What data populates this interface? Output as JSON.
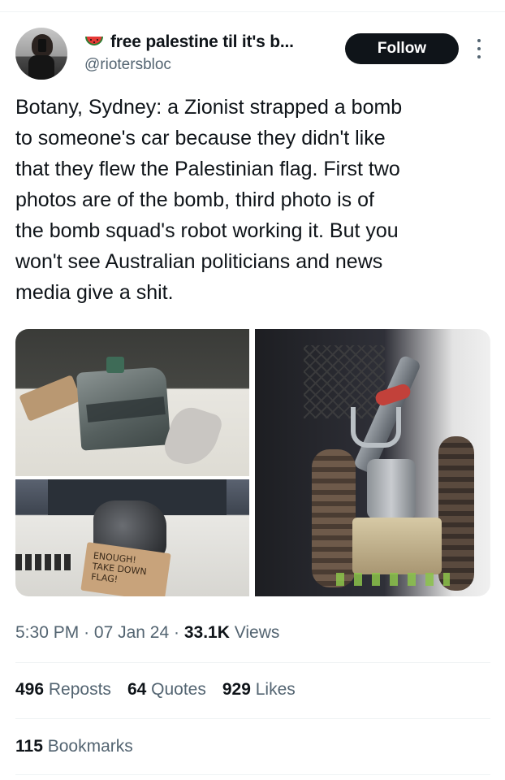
{
  "author": {
    "display_name": "free palestine til it's b...",
    "handle": "@riotersbloc",
    "emoji_icon": "watermelon-icon"
  },
  "follow_label": "Follow",
  "tweet_text": "Botany, Sydney: a Zionist strapped a bomb\nto someone's car because they didn't like\nthat they flew the Palestinian flag. First two\nphotos are of the bomb, third photo is of\nthe bomb squad's robot working it. But you\nwon't see Australian politicians and news\nmedia give a shit.",
  "photo_sign_text": "ENOUGH!\nTAKE DOWN\nFLAG!",
  "meta": {
    "time": "5:30 PM",
    "sep": "·",
    "date": "07 Jan 24",
    "views_count": "33.1K",
    "views_label": "Views"
  },
  "stats": [
    {
      "count": "496",
      "label": "Reposts"
    },
    {
      "count": "64",
      "label": "Quotes"
    },
    {
      "count": "929",
      "label": "Likes"
    }
  ],
  "bookmarks": {
    "count": "115",
    "label": "Bookmarks"
  },
  "colors": {
    "text": "#0f1419",
    "secondary": "#536471",
    "follow_bg": "#0f1419",
    "divider": "#eff3f4"
  }
}
